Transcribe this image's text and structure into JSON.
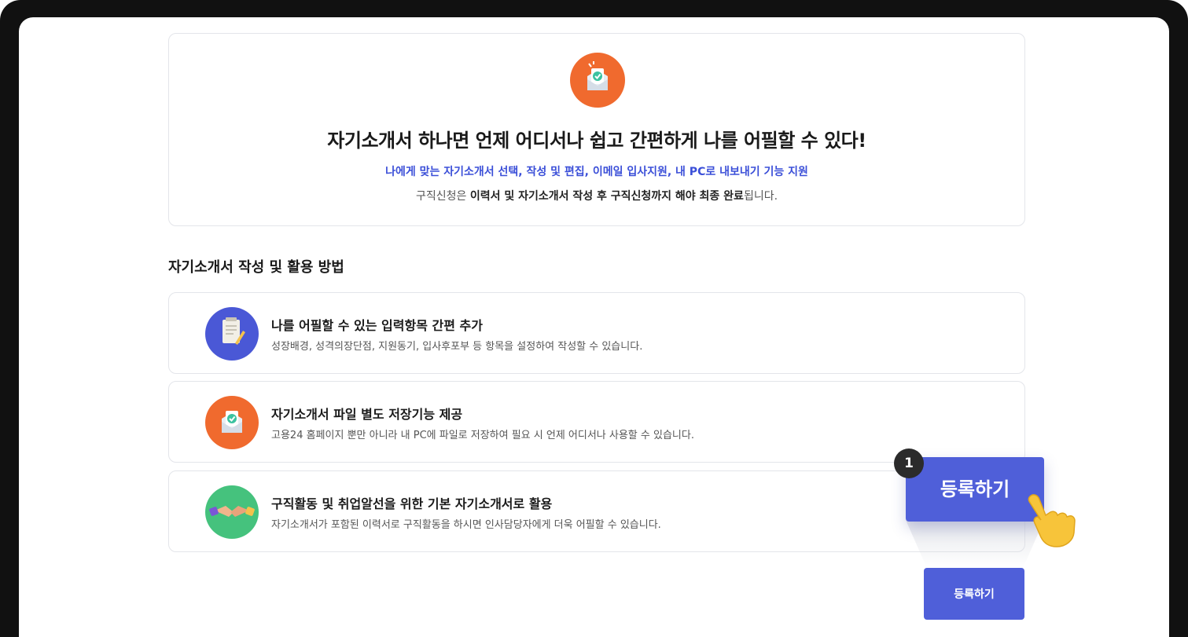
{
  "hero": {
    "icon": "document-check-icon",
    "title": "자기소개서 하나면 언제 어디서나 쉽고 간편하게 나를 어필할 수 있다!",
    "subtitle": "나에게 맞는 자기소개서 선택, 작성 및 편집, 이메일 입사지원, 내 PC로 내보내기 기능 지원",
    "note_prefix": "구직신청은 ",
    "note_bold": "이력서 및 자기소개서 작성 후 구직신청까지 해야 최종 완료",
    "note_suffix": "됩니다."
  },
  "section_title": "자기소개서 작성 및 활용 방법",
  "items": [
    {
      "icon": "document-pen-icon",
      "icon_color": "#4a58d6",
      "title": "나를 어필할 수 있는 입력항목 간편 추가",
      "desc": "성장배경, 성격의장단점, 지원동기, 입사후포부 등 항목을 설정하여 작성할 수 있습니다."
    },
    {
      "icon": "envelope-check-icon",
      "icon_color": "#f06a2e",
      "title": "자기소개서 파일 별도 저장기능 제공",
      "desc": "고용24 홈페이지 뿐만 아니라 내 PC에 파일로 저장하여 필요 시 언제 어디서나 사용할 수 있습니다."
    },
    {
      "icon": "handshake-icon",
      "icon_color": "#45c27d",
      "title": "구직활동 및 취업알선을 위한 기본 자기소개서로 활용",
      "desc": "자기소개서가 포함된 이력서로 구직활동을 하시면 인사담당자에게 더욱 어필할 수 있습니다."
    }
  ],
  "register_button": "등록하기",
  "callout": {
    "step": "1",
    "label": "등록하기",
    "pointer": "hand-pointer-icon"
  },
  "colors": {
    "accent": "#4f5fd9",
    "subtitle": "#3b4fd8"
  }
}
